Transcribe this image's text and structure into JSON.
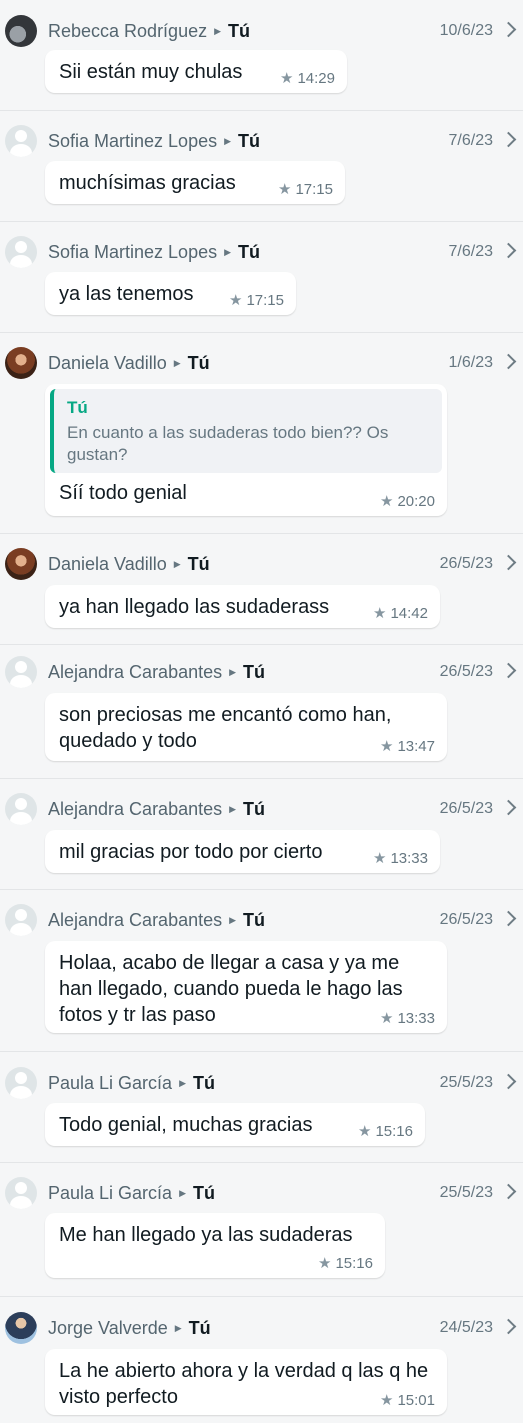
{
  "recipient_label": "Tú",
  "entries": [
    {
      "sender": "Rebecca Rodríguez",
      "date": "10/6/23",
      "avatar": "photo",
      "message": "Sii están muy chulas",
      "time": "14:29"
    },
    {
      "sender": "Sofia Martinez Lopes",
      "date": "7/6/23",
      "avatar": "default",
      "message": "muchísimas gracias",
      "time": "17:15"
    },
    {
      "sender": "Sofia Martinez Lopes",
      "date": "7/6/23",
      "avatar": "default",
      "message": "ya las tenemos",
      "time": "17:15"
    },
    {
      "sender": "Daniela Vadillo",
      "date": "1/6/23",
      "avatar": "photo",
      "quote": {
        "author": "Tú",
        "text": "En cuanto a las sudaderas todo bien?? Os gustan?"
      },
      "message": "Síí todo genial",
      "time": "20:20"
    },
    {
      "sender": "Daniela Vadillo",
      "date": "26/5/23",
      "avatar": "photo",
      "message": "ya han llegado las sudaderass",
      "time": "14:42"
    },
    {
      "sender": "Alejandra Carabantes",
      "date": "26/5/23",
      "avatar": "default",
      "message": "son preciosas me encantó como han, quedado y todo",
      "time": "13:47"
    },
    {
      "sender": "Alejandra Carabantes",
      "date": "26/5/23",
      "avatar": "default",
      "message": "mil gracias por todo por cierto",
      "time": "13:33"
    },
    {
      "sender": "Alejandra Carabantes",
      "date": "26/5/23",
      "avatar": "default",
      "message": "Holaa, acabo de llegar a casa y ya me han llegado, cuando pueda le hago las fotos y tr las paso",
      "time": "13:33"
    },
    {
      "sender": "Paula Li García",
      "date": "25/5/23",
      "avatar": "default",
      "message": "Todo genial, muchas gracias",
      "time": "15:16"
    },
    {
      "sender": "Paula Li García",
      "date": "25/5/23",
      "avatar": "default",
      "message": "Me han llegado ya las sudaderas",
      "time": "15:16"
    },
    {
      "sender": "Jorge Valverde",
      "date": "24/5/23",
      "avatar": "photo",
      "message": "La he abierto ahora y la verdad q las q he visto perfecto",
      "time": "15:01"
    }
  ]
}
